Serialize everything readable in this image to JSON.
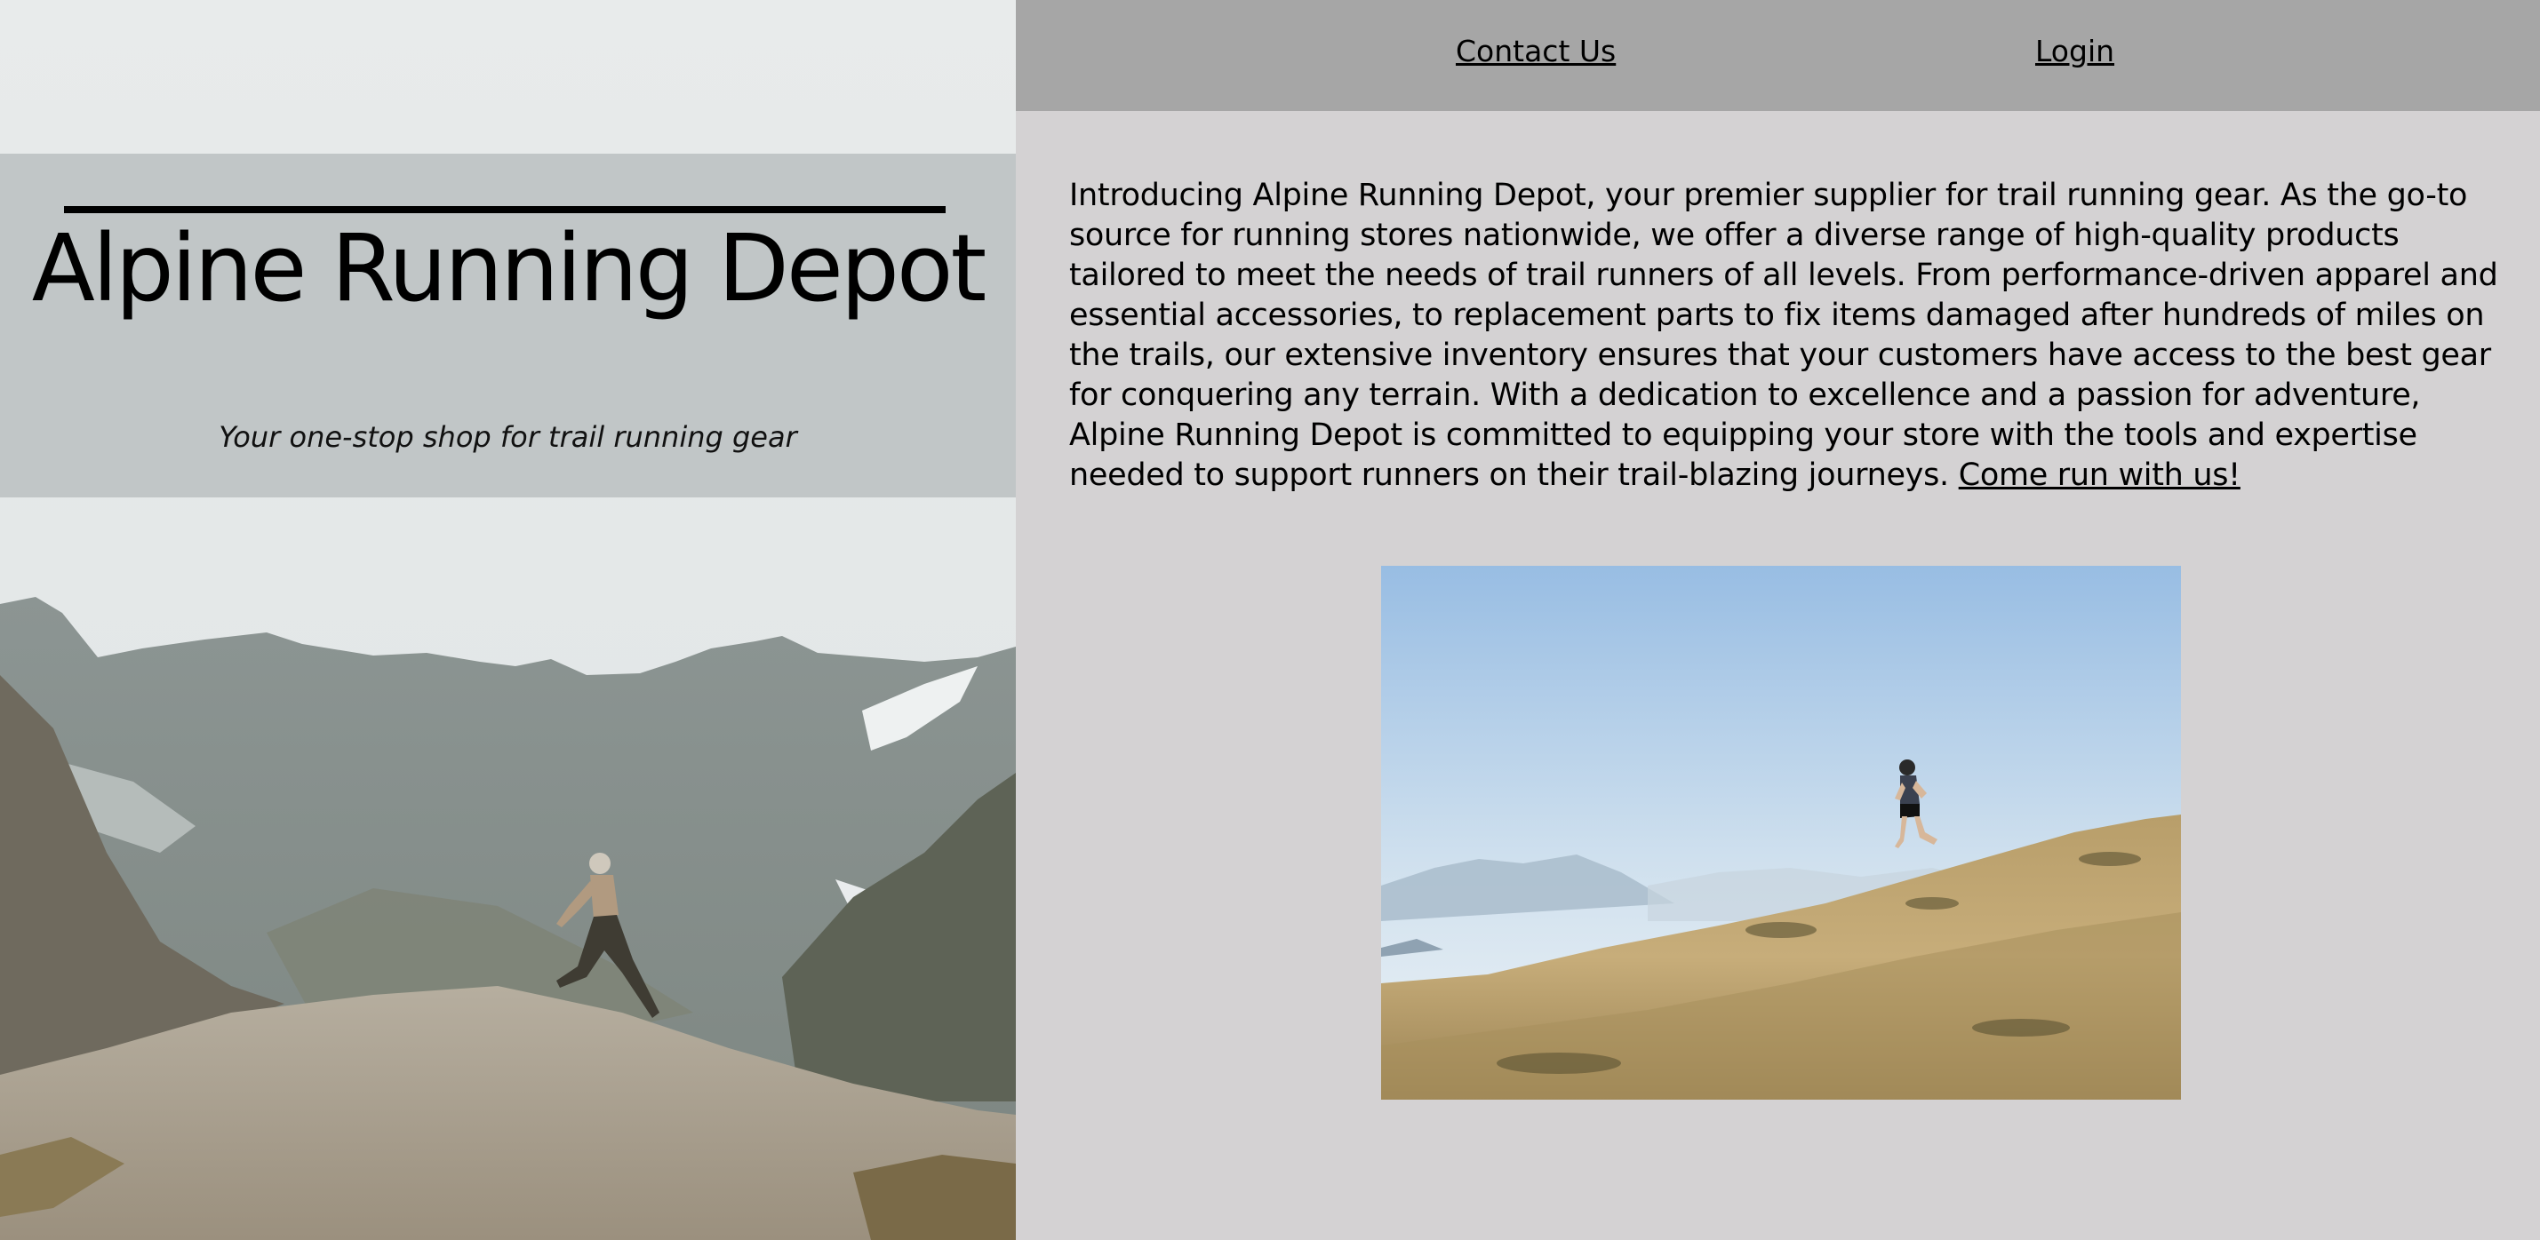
{
  "site": {
    "title": "Alpine Running Depot",
    "tagline": "Your one-stop shop for trail running gear"
  },
  "nav": {
    "contact_label": "Contact Us",
    "login_label": "Login"
  },
  "intro": {
    "body": "Introducing Alpine Running Depot, your premier supplier for trail running gear. As the go-to source for running stores nationwide, we offer a diverse range of high-quality products tailored to meet the needs of trail runners of all levels. From performance-driven apparel and essential accessories, to replacement parts to fix items damaged after hundreds of miles on the trails, our extensive inventory ensures that your customers have access to the best gear for conquering any terrain. With a dedication to excellence and a passion for adventure, Alpine Running Depot is committed to equipping your store with the tools and expertise needed to support runners on their trail-blazing journeys. ",
    "cta_label": "Come run with us!"
  },
  "colors": {
    "page_background": "#d4d2d3",
    "nav_background": "#a6a6a6",
    "title_band": "#bcc0c2",
    "text": "#000000"
  },
  "images": {
    "hero": "mountain-runner-photo",
    "secondary": "hillside-runner-photo"
  }
}
